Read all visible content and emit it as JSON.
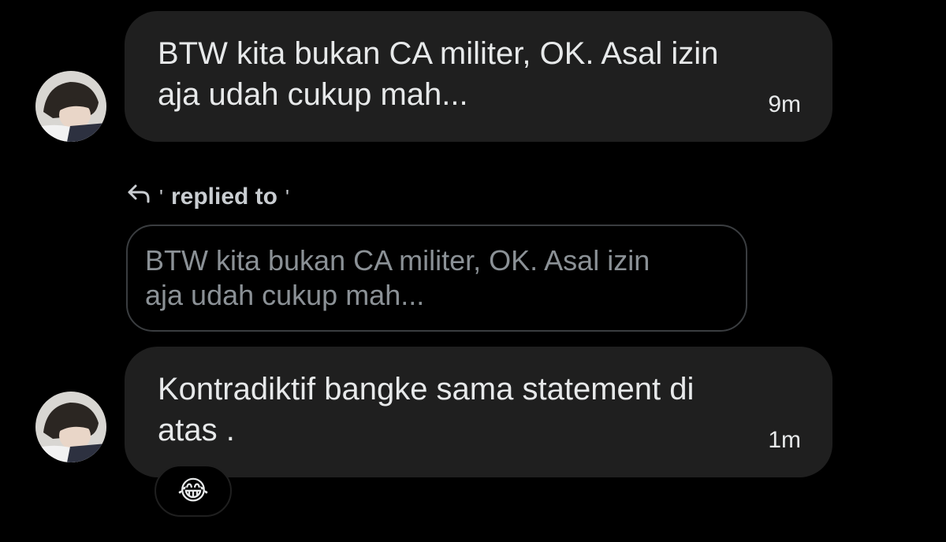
{
  "messages": [
    {
      "text_line1": "BTW kita bukan CA militer, OK. Asal izin",
      "text_line2": "aja udah cukup mah...",
      "time": "9m"
    },
    {
      "text_line1": "Kontradiktif bangke sama statement di",
      "text_line2": "atas .",
      "time": "1m",
      "reaction": "😂",
      "reply": {
        "label": "replied to",
        "quote_line1": "BTW kita bukan CA militer, OK. Asal izin",
        "quote_line2": "aja udah cukup mah..."
      }
    }
  ],
  "icons": {
    "reply": "reply-arrow-icon",
    "avatar": "avatar"
  },
  "colors": {
    "background": "#000000",
    "bubble": "#1f1f1f",
    "text": "#e7e9ea",
    "quote_text": "#8b9196",
    "quote_border": "#3a3d40"
  }
}
